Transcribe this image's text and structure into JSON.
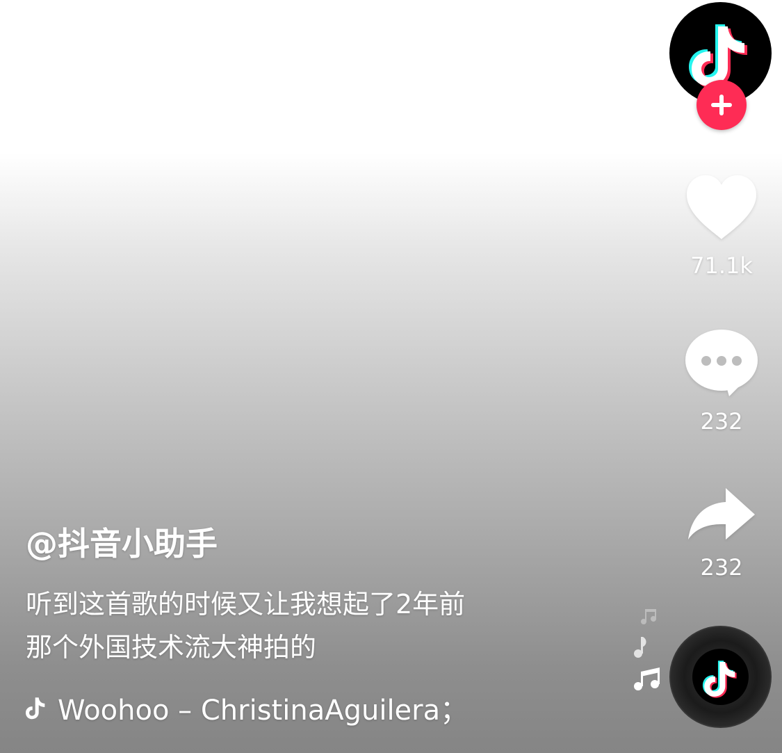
{
  "author": {
    "handle": "@抖音小助手",
    "avatar_icon": "tiktok-logo-icon",
    "follow_icon": "plus-icon"
  },
  "video": {
    "caption_line1": "听到这首歌的时候又让我想起了2年前",
    "caption_line2": "那个外国技术流大神拍的"
  },
  "actions": {
    "like_count": "71.1k",
    "comment_count": "232",
    "share_count": "232"
  },
  "music": {
    "title": "Woohoo – ChristinaAguilera；",
    "disc_icon": "tiktok-logo-icon"
  },
  "colors": {
    "brand_red": "#fe2c55",
    "brand_cyan": "#25f4ee",
    "white": "#ffffff"
  }
}
